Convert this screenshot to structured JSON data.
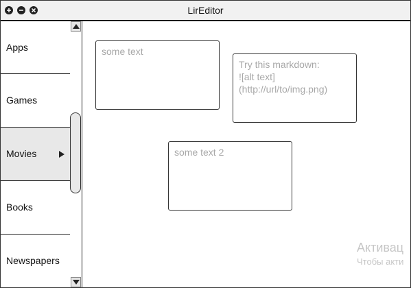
{
  "window": {
    "title": "LirEditor",
    "controls": [
      {
        "name": "plus-icon"
      },
      {
        "name": "minus-icon"
      },
      {
        "name": "close-icon"
      }
    ]
  },
  "sidebar": {
    "items": [
      {
        "label": "Apps",
        "selected": false
      },
      {
        "label": "Games",
        "selected": false
      },
      {
        "label": "Movies",
        "selected": true,
        "icon": "chevron-right-icon"
      },
      {
        "label": "Books",
        "selected": false
      },
      {
        "label": "Newspapers",
        "selected": false
      }
    ]
  },
  "scrollbar": {
    "up_icon": "arrow-up-icon",
    "down_icon": "arrow-down-icon"
  },
  "notes": [
    {
      "text": "some text"
    },
    {
      "text": "Try this markdown:\n![alt text]\n(http://url/to/img.png)"
    },
    {
      "text": "some text 2"
    }
  ],
  "overlay": {
    "line1": "Активац",
    "line2": "Чтобы акти"
  },
  "colors": {
    "border": "#222222",
    "selected_bg": "#e8e8e8",
    "note_text": "#a8a8a8",
    "titlebar_bg": "#f1f1f1"
  }
}
